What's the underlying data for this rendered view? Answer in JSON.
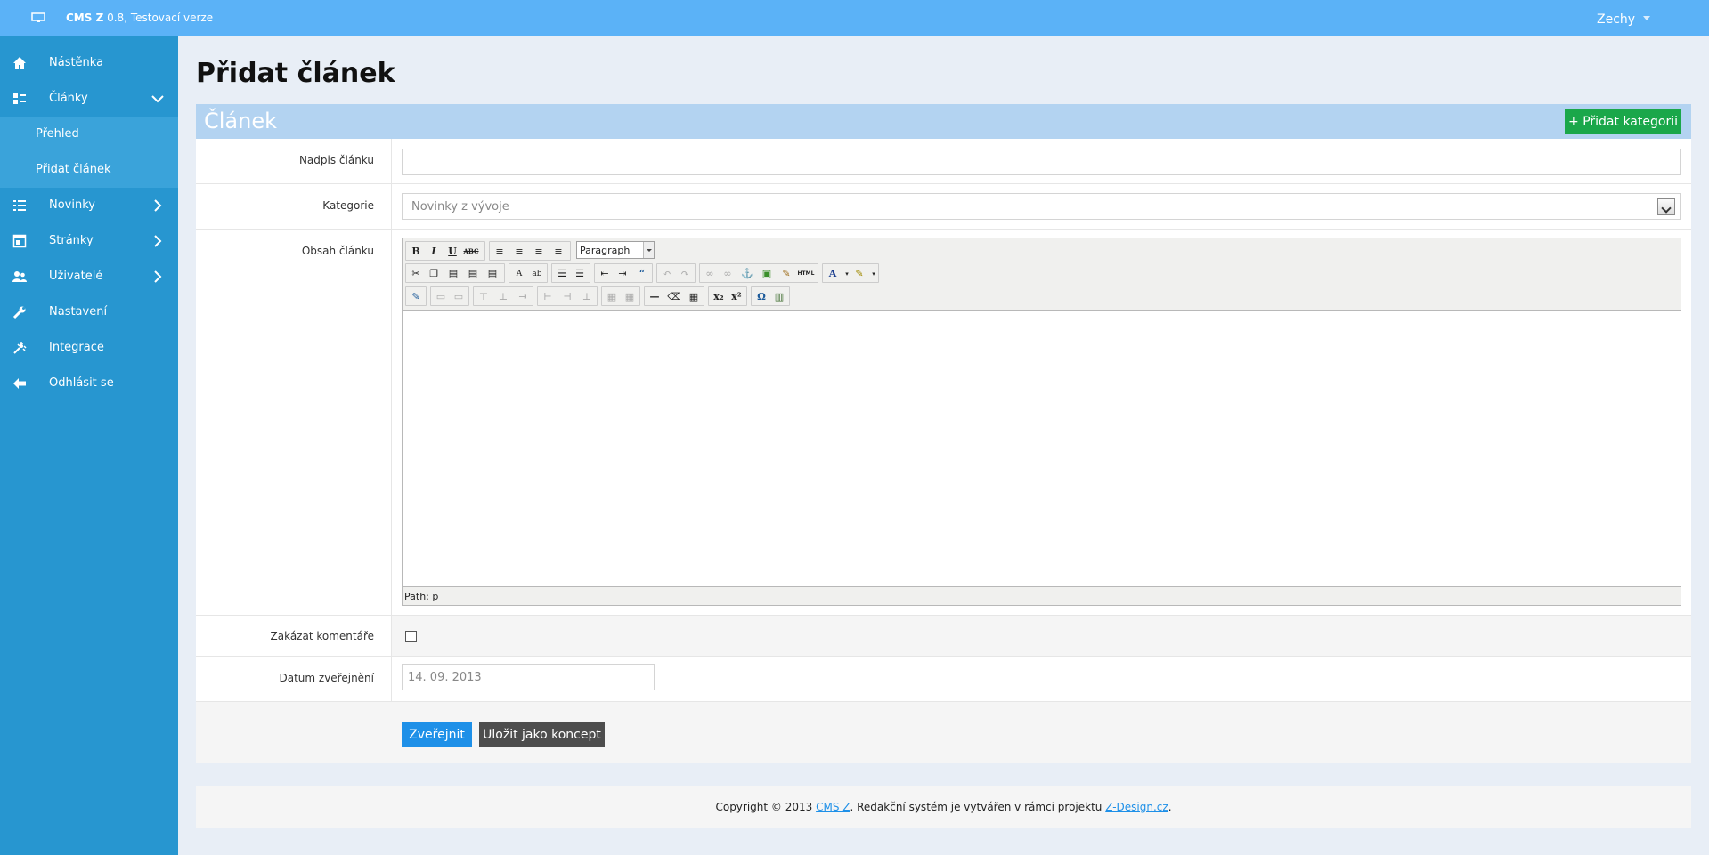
{
  "topbar": {
    "app_name": "CMS Z",
    "app_version": "0.8, Testovací verze",
    "user": "Zechy"
  },
  "sidebar": {
    "items": [
      {
        "label": "Nástěnka",
        "icon": "home-icon"
      },
      {
        "label": "Články",
        "icon": "articles-icon"
      },
      {
        "label": "Novinky",
        "icon": "list-icon"
      },
      {
        "label": "Stránky",
        "icon": "pages-icon"
      },
      {
        "label": "Uživatelé",
        "icon": "users-icon"
      },
      {
        "label": "Nastavení",
        "icon": "wrench-icon"
      },
      {
        "label": "Integrace",
        "icon": "integration-icon"
      },
      {
        "label": "Odhlásit se",
        "icon": "logout-icon"
      }
    ],
    "sub_items": [
      {
        "label": "Přehled"
      },
      {
        "label": "Přidat článek"
      }
    ]
  },
  "page": {
    "title": "Přidat článek",
    "panel_title": "Článek",
    "add_category_button": "+ Přidat kategorii"
  },
  "form": {
    "title_label": "Nadpis článku",
    "title_value": "",
    "category_label": "Kategorie",
    "category_value": "Novinky z vývoje",
    "content_label": "Obsah článku",
    "editor_format": "Paragraph",
    "editor_path": "Path: p",
    "disable_comments_label": "Zakázat komentáře",
    "disable_comments_checked": false,
    "publish_date_label": "Datum zveřejnění",
    "publish_date_value": "14. 09. 2013",
    "publish_button": "Zveřejnit",
    "draft_button": "Uložit jako koncept"
  },
  "footer": {
    "prefix": "Copyright © 2013",
    "cms_link": "CMS Z",
    "middle": ". Redakční systém je vytvářen v rámci projektu",
    "project_link": "Z-Design.cz",
    "suffix": "."
  },
  "colors": {
    "topbar": "#5bb2f7",
    "sidebar": "#2796d0",
    "panel_header": "#b3d3f1",
    "add_button": "#1aa74a",
    "publish_button": "#1e90e8",
    "draft_button": "#4d4d4d"
  }
}
